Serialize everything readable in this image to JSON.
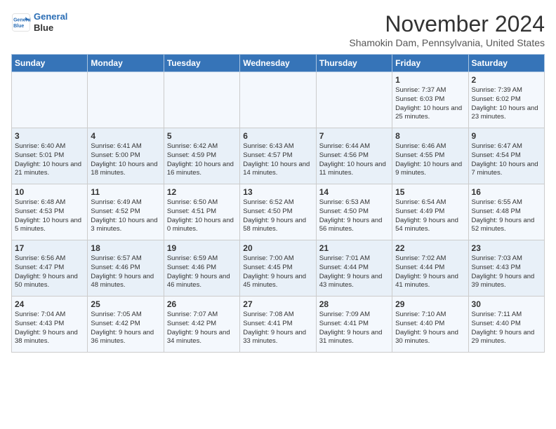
{
  "header": {
    "logo_line1": "General",
    "logo_line2": "Blue",
    "month": "November 2024",
    "location": "Shamokin Dam, Pennsylvania, United States"
  },
  "days_of_week": [
    "Sunday",
    "Monday",
    "Tuesday",
    "Wednesday",
    "Thursday",
    "Friday",
    "Saturday"
  ],
  "weeks": [
    [
      {
        "day": "",
        "info": ""
      },
      {
        "day": "",
        "info": ""
      },
      {
        "day": "",
        "info": ""
      },
      {
        "day": "",
        "info": ""
      },
      {
        "day": "",
        "info": ""
      },
      {
        "day": "1",
        "info": "Sunrise: 7:37 AM\nSunset: 6:03 PM\nDaylight: 10 hours and 25 minutes."
      },
      {
        "day": "2",
        "info": "Sunrise: 7:39 AM\nSunset: 6:02 PM\nDaylight: 10 hours and 23 minutes."
      }
    ],
    [
      {
        "day": "3",
        "info": "Sunrise: 6:40 AM\nSunset: 5:01 PM\nDaylight: 10 hours and 21 minutes."
      },
      {
        "day": "4",
        "info": "Sunrise: 6:41 AM\nSunset: 5:00 PM\nDaylight: 10 hours and 18 minutes."
      },
      {
        "day": "5",
        "info": "Sunrise: 6:42 AM\nSunset: 4:59 PM\nDaylight: 10 hours and 16 minutes."
      },
      {
        "day": "6",
        "info": "Sunrise: 6:43 AM\nSunset: 4:57 PM\nDaylight: 10 hours and 14 minutes."
      },
      {
        "day": "7",
        "info": "Sunrise: 6:44 AM\nSunset: 4:56 PM\nDaylight: 10 hours and 11 minutes."
      },
      {
        "day": "8",
        "info": "Sunrise: 6:46 AM\nSunset: 4:55 PM\nDaylight: 10 hours and 9 minutes."
      },
      {
        "day": "9",
        "info": "Sunrise: 6:47 AM\nSunset: 4:54 PM\nDaylight: 10 hours and 7 minutes."
      }
    ],
    [
      {
        "day": "10",
        "info": "Sunrise: 6:48 AM\nSunset: 4:53 PM\nDaylight: 10 hours and 5 minutes."
      },
      {
        "day": "11",
        "info": "Sunrise: 6:49 AM\nSunset: 4:52 PM\nDaylight: 10 hours and 3 minutes."
      },
      {
        "day": "12",
        "info": "Sunrise: 6:50 AM\nSunset: 4:51 PM\nDaylight: 10 hours and 0 minutes."
      },
      {
        "day": "13",
        "info": "Sunrise: 6:52 AM\nSunset: 4:50 PM\nDaylight: 9 hours and 58 minutes."
      },
      {
        "day": "14",
        "info": "Sunrise: 6:53 AM\nSunset: 4:50 PM\nDaylight: 9 hours and 56 minutes."
      },
      {
        "day": "15",
        "info": "Sunrise: 6:54 AM\nSunset: 4:49 PM\nDaylight: 9 hours and 54 minutes."
      },
      {
        "day": "16",
        "info": "Sunrise: 6:55 AM\nSunset: 4:48 PM\nDaylight: 9 hours and 52 minutes."
      }
    ],
    [
      {
        "day": "17",
        "info": "Sunrise: 6:56 AM\nSunset: 4:47 PM\nDaylight: 9 hours and 50 minutes."
      },
      {
        "day": "18",
        "info": "Sunrise: 6:57 AM\nSunset: 4:46 PM\nDaylight: 9 hours and 48 minutes."
      },
      {
        "day": "19",
        "info": "Sunrise: 6:59 AM\nSunset: 4:46 PM\nDaylight: 9 hours and 46 minutes."
      },
      {
        "day": "20",
        "info": "Sunrise: 7:00 AM\nSunset: 4:45 PM\nDaylight: 9 hours and 45 minutes."
      },
      {
        "day": "21",
        "info": "Sunrise: 7:01 AM\nSunset: 4:44 PM\nDaylight: 9 hours and 43 minutes."
      },
      {
        "day": "22",
        "info": "Sunrise: 7:02 AM\nSunset: 4:44 PM\nDaylight: 9 hours and 41 minutes."
      },
      {
        "day": "23",
        "info": "Sunrise: 7:03 AM\nSunset: 4:43 PM\nDaylight: 9 hours and 39 minutes."
      }
    ],
    [
      {
        "day": "24",
        "info": "Sunrise: 7:04 AM\nSunset: 4:43 PM\nDaylight: 9 hours and 38 minutes."
      },
      {
        "day": "25",
        "info": "Sunrise: 7:05 AM\nSunset: 4:42 PM\nDaylight: 9 hours and 36 minutes."
      },
      {
        "day": "26",
        "info": "Sunrise: 7:07 AM\nSunset: 4:42 PM\nDaylight: 9 hours and 34 minutes."
      },
      {
        "day": "27",
        "info": "Sunrise: 7:08 AM\nSunset: 4:41 PM\nDaylight: 9 hours and 33 minutes."
      },
      {
        "day": "28",
        "info": "Sunrise: 7:09 AM\nSunset: 4:41 PM\nDaylight: 9 hours and 31 minutes."
      },
      {
        "day": "29",
        "info": "Sunrise: 7:10 AM\nSunset: 4:40 PM\nDaylight: 9 hours and 30 minutes."
      },
      {
        "day": "30",
        "info": "Sunrise: 7:11 AM\nSunset: 4:40 PM\nDaylight: 9 hours and 29 minutes."
      }
    ]
  ]
}
